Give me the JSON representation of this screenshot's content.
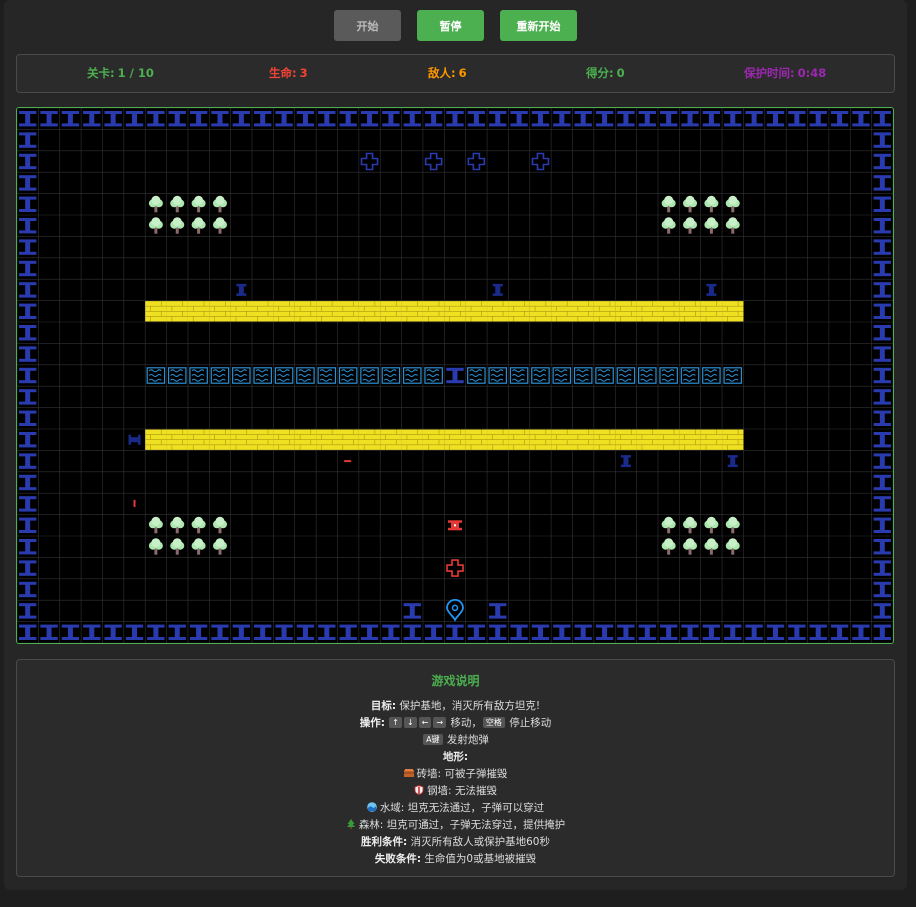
{
  "controls": {
    "start_label": "开始",
    "pause_label": "暂停",
    "restart_label": "重新开始"
  },
  "status": {
    "level_label": "关卡:",
    "level_value": "1 / 10",
    "lives_label": "生命:",
    "lives_value": "3",
    "enemies_label": "敌人:",
    "enemies_value": "6",
    "score_label": "得分:",
    "score_value": "0",
    "shield_label": "保护时间:",
    "shield_value": "0:48"
  },
  "colors": {
    "level": "#4caf50",
    "lives": "#f44336",
    "enemies": "#ff9800",
    "score": "#4caf50",
    "shield": "#9c27b0",
    "brick": "#f0e022",
    "steel": "#2a3bb0",
    "water": "#2d8fd0",
    "tree": "#aee6b0",
    "enemy_tank": "#1a2a8a",
    "player_tank": "#e53935",
    "base": "#2196f3",
    "board_border": "#4caf50"
  },
  "board": {
    "cols": 41,
    "rows": 25
  },
  "help": {
    "title": "游戏说明",
    "goal_label": "目标:",
    "goal_text": "保护基地，消灭所有敌方坦克!",
    "ops_label": "操作:",
    "key_up": "↑",
    "key_down": "↓",
    "key_left": "←",
    "key_right": "→",
    "move_text": "移动，",
    "key_space": "空格",
    "stop_text": "停止移动",
    "key_a": "A键",
    "fire_text": "发射炮弹",
    "terrain_label": "地形:",
    "brick_text": "砖墙: 可被子弹摧毁",
    "brick_icon": "brick-icon",
    "steel_text": "钢墙: 无法摧毁",
    "steel_icon": "shield-icon",
    "water_text": "水域: 坦克无法通过，子弹可以穿过",
    "water_icon": "wave-icon",
    "forest_text": "森林: 坦克可通过，子弹无法穿过，提供掩护",
    "forest_icon": "tree-icon",
    "win_label": "胜利条件:",
    "win_text": "消灭所有敌人或保护基地60秒",
    "lose_label": "失败条件:",
    "lose_text": "生命值为0或基地被摧毁"
  }
}
